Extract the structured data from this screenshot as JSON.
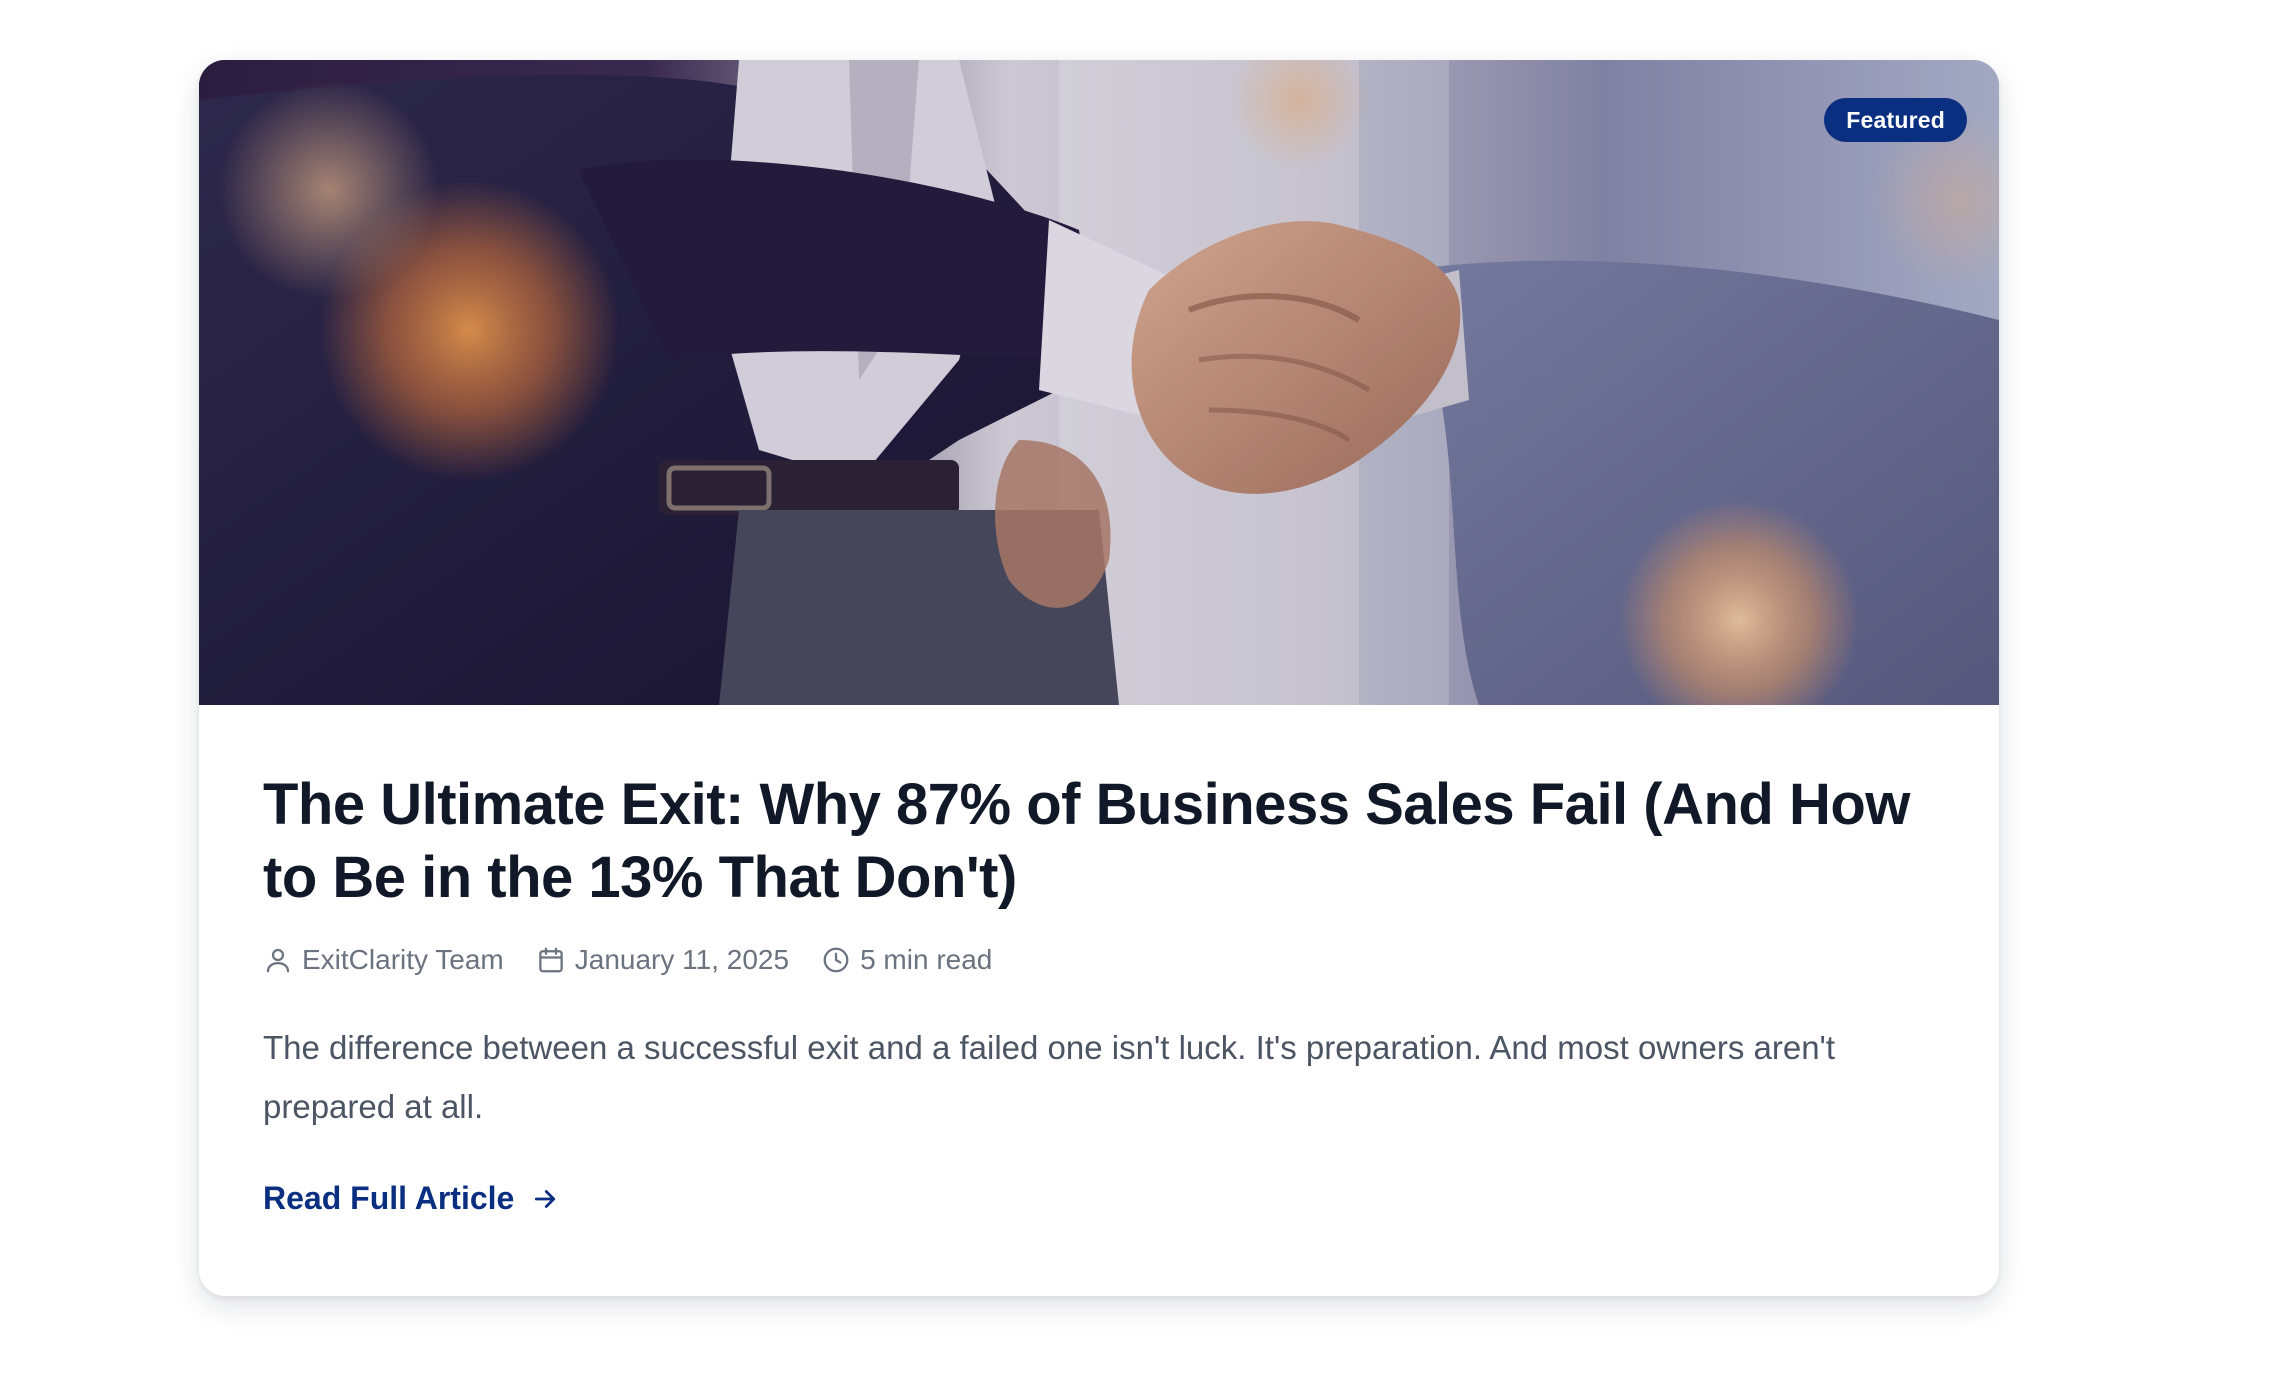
{
  "card": {
    "badge": "Featured",
    "hero_alt": "Business handshake",
    "title": "The Ultimate Exit: Why 87% of Business Sales Fail (And How to Be in the 13% That Don't)",
    "meta": {
      "author": "ExitClarity Team",
      "author_icon": "user-icon",
      "date": "January 11, 2025",
      "date_icon": "calendar-icon",
      "read_time": "5 min read",
      "read_time_icon": "clock-icon"
    },
    "excerpt": "The difference between a successful exit and a failed one isn't luck. It's preparation. And most owners aren't prepared at all.",
    "cta_label": "Read Full Article",
    "cta_icon": "arrow-right-icon"
  },
  "colors": {
    "brand": "#0b2f80",
    "title": "#111827",
    "meta": "#6b7280",
    "body": "#4b5563"
  }
}
